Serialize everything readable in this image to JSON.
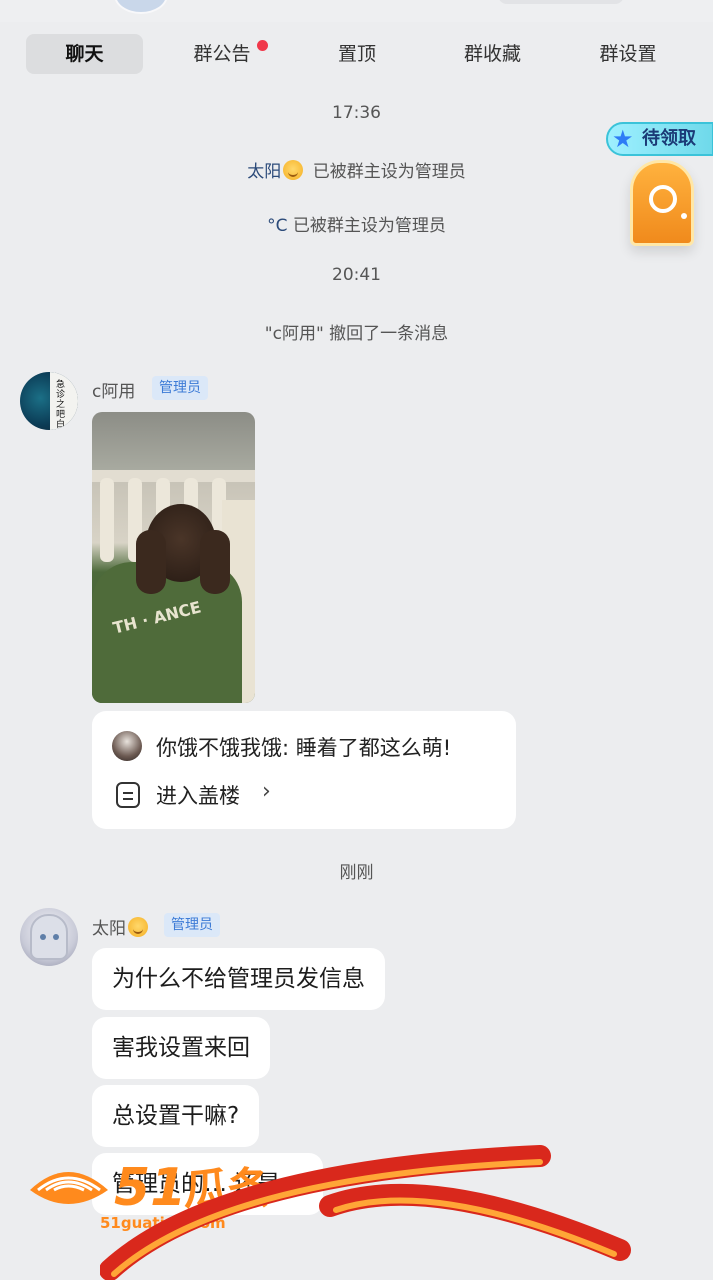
{
  "tabs": [
    {
      "label": "聊天",
      "active": true
    },
    {
      "label": "群公告",
      "has_dot": true
    },
    {
      "label": "置顶"
    },
    {
      "label": "群收藏"
    },
    {
      "label": "群设置"
    }
  ],
  "timeline": {
    "time_1": "17:36",
    "event_1_name": "太阳",
    "event_1_text": "已被群主设为管理员",
    "event_2_name": "°C",
    "event_2_text": "已被群主设为管理员",
    "time_2": "20:41",
    "recall_text": "\"c阿用\" 撤回了一条消息",
    "time_3": "刚刚"
  },
  "reward_badge": {
    "label": "待领取"
  },
  "messages": [
    {
      "sender": "c阿用",
      "role": "管理员",
      "avatar_text": "急诊 之 吧白",
      "reply": {
        "text": "你饿不饿我饿: 睡着了都这么萌!",
        "link": "进入盖楼",
        "chevron": "›"
      },
      "photo_print": "TH · ANCE"
    },
    {
      "sender": "太阳",
      "role": "管理员",
      "bubbles": [
        "为什么不给管理员发信息",
        "害我设置来回",
        "总设置干嘛?",
        "管理员的… 还是…"
      ]
    }
  ],
  "watermark": {
    "number": "51",
    "text": "瓜条",
    "url": "51guatiao.com"
  },
  "colors": {
    "accent_blue": "#3d7bd6",
    "badge_bg": "#dbe8f8",
    "dot_red": "#f0384a",
    "watermark_orange": "#ff8a1d"
  }
}
